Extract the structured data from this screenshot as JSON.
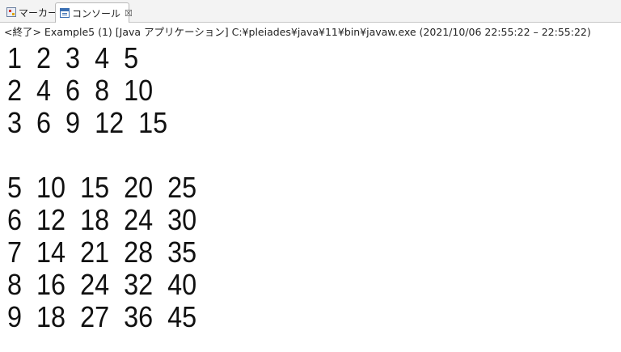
{
  "tabs": [
    {
      "label": "マーカー",
      "icon": "markers-icon"
    },
    {
      "label": "コンソール",
      "icon": "console-icon",
      "active": true,
      "close_glyph": "☒"
    }
  ],
  "status_line": "<終了> Example5 (1) [Java アプリケーション] C:¥pleiades¥java¥11¥bin¥javaw.exe  (2021/10/06 22:55:22 – 22:55:22)",
  "console": {
    "lines": [
      "1  2  3  4  5",
      "2  4  6  8  10",
      "3  6  9  12  15",
      "",
      "5  10  15  20  25",
      "6  12  18  24  30",
      "7  14  21  28  35",
      "8  16  24  32  40",
      "9  18  27  36  45"
    ]
  }
}
